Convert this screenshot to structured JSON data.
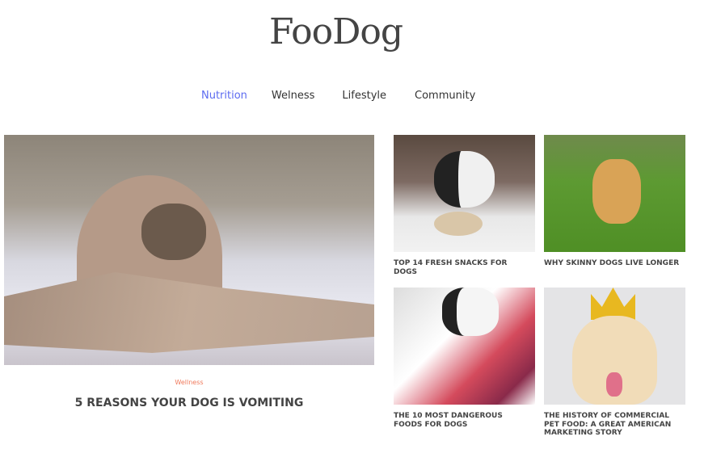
{
  "site": {
    "logo": "FooDog"
  },
  "nav": {
    "items": [
      {
        "label": "Nutrition",
        "active": true
      },
      {
        "label": "Welness"
      },
      {
        "label": "Lifestyle"
      },
      {
        "label": "Community"
      }
    ],
    "active_color": "#5c6bf0"
  },
  "featured": {
    "category": "Wellness",
    "title": "5 REASONS YOUR DOG IS VOMITING",
    "category_color": "#f07a5c"
  },
  "cards": [
    {
      "title": "TOP 14 FRESH SNACKS FOR DOGS"
    },
    {
      "title": "WHY SKINNY DOGS LIVE LONGER"
    },
    {
      "title": "THE 10 MOST DANGEROUS FOODS FOR DOGS"
    },
    {
      "title": "THE HISTORY OF COMMERCIAL PET FOOD: A GREAT AMERICAN MARKETING STORY"
    }
  ]
}
